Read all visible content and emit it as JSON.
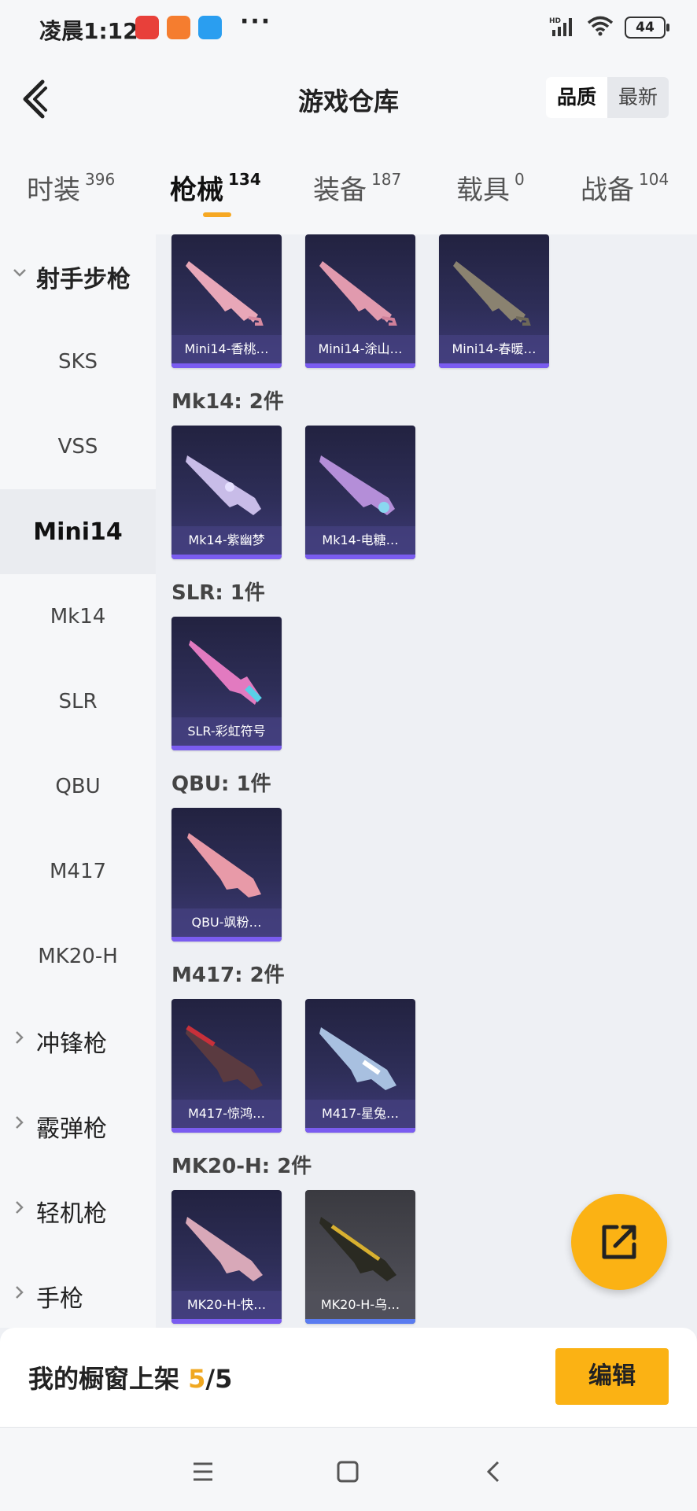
{
  "status": {
    "time": "凌晨1:12",
    "dots": "···",
    "network": "HD",
    "battery": "44"
  },
  "header": {
    "title": "游戏仓库",
    "sort_options": [
      "品质",
      "最新"
    ],
    "sort_selected": "品质"
  },
  "tabs": [
    {
      "label": "时装",
      "count": "396"
    },
    {
      "label": "枪械",
      "count": "134"
    },
    {
      "label": "装备",
      "count": "187"
    },
    {
      "label": "载具",
      "count": "0"
    },
    {
      "label": "战备",
      "count": "104"
    }
  ],
  "sidebar": {
    "items": [
      {
        "label": "射手步枪",
        "type": "group",
        "expanded": true
      },
      {
        "label": "SKS"
      },
      {
        "label": "VSS"
      },
      {
        "label": "Mini14",
        "active": true
      },
      {
        "label": "Mk14"
      },
      {
        "label": "SLR"
      },
      {
        "label": "QBU"
      },
      {
        "label": "M417"
      },
      {
        "label": "MK20-H"
      },
      {
        "label": "冲锋枪",
        "type": "group"
      },
      {
        "label": "霰弹枪",
        "type": "group"
      },
      {
        "label": "轻机枪",
        "type": "group"
      },
      {
        "label": "手枪",
        "type": "group"
      }
    ]
  },
  "sections": [
    {
      "label": "",
      "items": [
        "Mini14-香桃…",
        "Mini14-涂山…",
        "Mini14-春暖…"
      ]
    },
    {
      "label": "Mk14: 2件",
      "items": [
        "Mk14-紫幽梦",
        "Mk14-电糖…"
      ]
    },
    {
      "label": "SLR: 1件",
      "items": [
        "SLR-彩虹符号"
      ]
    },
    {
      "label": "QBU: 1件",
      "items": [
        "QBU-飒粉…"
      ]
    },
    {
      "label": "M417: 2件",
      "items": [
        "M417-惊鸿…",
        "M417-星兔…"
      ]
    },
    {
      "label": "MK20-H: 2件",
      "items": [
        "MK20-H-快…",
        "MK20-H-乌…"
      ]
    }
  ],
  "showcase": {
    "prefix": "我的橱窗上架 ",
    "count": "5",
    "total": "/5",
    "edit_label": "编辑"
  },
  "colors": {
    "accent": "#fbb214",
    "card_bg": "#2e2e58",
    "card_label_bg": "#46428a"
  }
}
